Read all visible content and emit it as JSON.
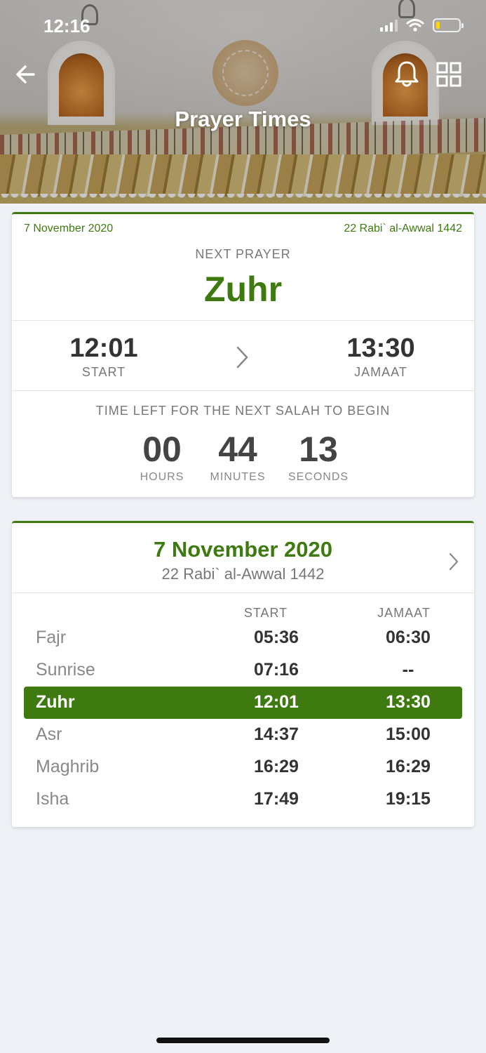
{
  "status_bar": {
    "time": "12:16",
    "icons": [
      "signal-icon",
      "wifi-icon",
      "battery-icon"
    ]
  },
  "header": {
    "title": "Prayer Times",
    "back_icon": "back-arrow-icon",
    "actions": [
      "bell-icon",
      "grid-icon"
    ]
  },
  "next_prayer_card": {
    "gregorian_date": "7 November 2020",
    "hijri_date": "22 Rabi` al-Awwal 1442",
    "label": "NEXT PRAYER",
    "name": "Zuhr",
    "start_time": "12:01",
    "start_label": "START",
    "jamaat_time": "13:30",
    "jamaat_label": "JAMAAT",
    "countdown_label": "TIME LEFT FOR THE NEXT SALAH TO BEGIN",
    "countdown": {
      "hours": "00",
      "hours_label": "HOURS",
      "minutes": "44",
      "minutes_label": "MINUTES",
      "seconds": "13",
      "seconds_label": "SECONDS"
    }
  },
  "daily_card": {
    "gregorian_date": "7 November 2020",
    "hijri_date": "22 Rabi` al-Awwal 1442",
    "start_header": "START",
    "jamaat_header": "JAMAAT",
    "rows": [
      {
        "name": "Fajr",
        "start": "05:36",
        "jamaat": "06:30"
      },
      {
        "name": "Sunrise",
        "start": "07:16",
        "jamaat": "--"
      },
      {
        "name": "Zuhr",
        "start": "12:01",
        "jamaat": "13:30"
      },
      {
        "name": "Asr",
        "start": "14:37",
        "jamaat": "15:00"
      },
      {
        "name": "Maghrib",
        "start": "16:29",
        "jamaat": "16:29"
      },
      {
        "name": "Isha",
        "start": "17:49",
        "jamaat": "19:15"
      }
    ],
    "active_row": "Zuhr"
  },
  "colors": {
    "accent": "#3e7a10",
    "background": "#eef1f5"
  }
}
